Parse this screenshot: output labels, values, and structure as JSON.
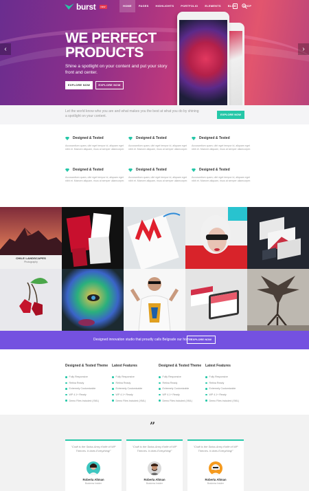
{
  "brand": {
    "name": "burst",
    "badge": "NEW",
    "accent": "#25c7a8",
    "purple": "#7451e0"
  },
  "nav": {
    "items": [
      "HOME",
      "PAGES",
      "HIGHLIGHTS",
      "PORTFOLIO",
      "ELEMENTS",
      "BLOG",
      "SHOP"
    ],
    "active": "HOME",
    "cart_count": "0"
  },
  "hero": {
    "title_line1": "WE PERFECT",
    "title_line2": "PRODUCTS",
    "subtitle": "Shine a spotlight on your content and put your story front and center.",
    "button_primary": "EXPLORE NOW",
    "button_secondary": "EXPLORE NOW"
  },
  "infobar": {
    "text": "Let the world know who you are and what makes you the best at what you do by shining a spotlight on your content.",
    "button": "EXPLORE NOW"
  },
  "features": [
    {
      "title": "Designed & Tested",
      "desc": "Accusantium quam, ultri eget tempor id, aliquam eget nibh et. Maecen aliquam, risus at semper ullamcorper."
    },
    {
      "title": "Designed & Tested",
      "desc": "Accusantium quam, ultri eget tempor id, aliquam eget nibh et. Maecen aliquam, risus at semper ullamcorper."
    },
    {
      "title": "Designed & Tested",
      "desc": "Accusantium quam, ultri eget tempor id, aliquam eget nibh et. Maecen aliquam, risus at semper ullamcorper."
    },
    {
      "title": "Designed & Tested",
      "desc": "Accusantium quam, ultri eget tempor id, aliquam eget nibh et. Maecen aliquam, risus at semper ullamcorper."
    },
    {
      "title": "Designed & Tested",
      "desc": "Accusantium quam, ultri eget tempor id, aliquam eget nibh et. Maecen aliquam, risus at semper ullamcorper."
    },
    {
      "title": "Designed & Tested",
      "desc": "Accusantium quam, ultri eget tempor id, aliquam eget nibh et. Maecen aliquam, risus at semper ullamcorper."
    }
  ],
  "portfolio": {
    "featured_title": "CHILE LANDSCAPES",
    "featured_category": "Photography"
  },
  "purplebar": {
    "text": "Designed innovation studio that proudly calls Belgrade our home",
    "button": "EXPLORE NOW"
  },
  "lists": [
    {
      "title": "Designed & Tested Theme",
      "items": [
        "Fully Responsive",
        "Retina Ready",
        "Extremely Customizable",
        "WP 4.1+ Ready",
        "Demo Files Included (XML)"
      ]
    },
    {
      "title": "Latest Features",
      "items": [
        "Fully Responsive",
        "Retina Ready",
        "Extremely Customizable",
        "WP 4.1+ Ready",
        "Demo Files Included (XML)"
      ]
    },
    {
      "title": "Designed & Tested Theme",
      "items": [
        "Fully Responsive",
        "Retina Ready",
        "Extremely Customizable",
        "WP 4.1+ Ready",
        "Demo Files Included (XML)"
      ]
    },
    {
      "title": "Latest Features",
      "items": [
        "Fully Responsive",
        "Retina Ready",
        "Extremely Customizable",
        "WP 4.1+ Ready",
        "Demo Files Included (XML)"
      ]
    }
  ],
  "testimonials": {
    "quote_symbol": "”",
    "items": [
      {
        "quote": "\"Craft is the Swiss Army Knife of WP Themes. It does Everything!\"",
        "name": "Roberta Altman",
        "role": "Business Insider"
      },
      {
        "quote": "\"Craft is the Swiss Army Knife of WP Themes. It does Everything!\"",
        "name": "Roberta Altman",
        "role": "Business Insider"
      },
      {
        "quote": "\"Craft is the Swiss Army Knife of WP Themes. It does Everything!\"",
        "name": "Roberta Altman",
        "role": "Business Insider"
      }
    ]
  }
}
